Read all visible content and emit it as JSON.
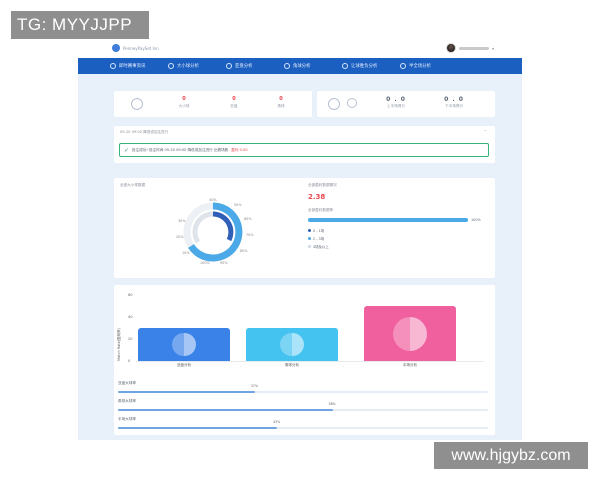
{
  "watermarks": {
    "top_left": "TG: MYYJJPP",
    "bottom_right": "www.hjgybz.com"
  },
  "header": {
    "logo_text": "PenneyPaySet Inn"
  },
  "nav": {
    "items": [
      {
        "label": "即时赛事资讯"
      },
      {
        "label": "大小球分析"
      },
      {
        "label": "亚盘分析"
      },
      {
        "label": "角球分析"
      },
      {
        "label": "让球胜负分析"
      },
      {
        "label": "半全场分析"
      }
    ]
  },
  "stats_left": [
    {
      "value": "0",
      "label": "大小球"
    },
    {
      "value": "0",
      "label": "亚盘"
    },
    {
      "value": "0",
      "label": "角球"
    }
  ],
  "stats_right": [
    {
      "value": "0 . 0",
      "label": "上半场得分"
    },
    {
      "value": "0 . 0",
      "label": "下半场得分"
    }
  ],
  "notice": {
    "header": "09-20 09:00 降低或加注进行",
    "text": "投注成功! 投注时间 09-20 09:00 降低或加注进行 比赛场数",
    "tag": "盈利 0.00"
  },
  "overview": {
    "left_title": "全部大小球数据",
    "right_title": "全部盈利数据情况",
    "big_value": "2.38",
    "progress_title": "全部盈利数据率",
    "progress_pct": 100,
    "progress_label": "100%",
    "legend": [
      {
        "label": "0 - 1场",
        "color": "#2f5fb8"
      },
      {
        "label": "2 - 3场",
        "color": "#4aa9e6"
      },
      {
        "label": "4场及以上",
        "color": "#cfd8e3"
      }
    ],
    "donut_labels": [
      "40%",
      "50%",
      "60%",
      "70%",
      "80%",
      "90%",
      "100%",
      "10%",
      "20%",
      "30%"
    ]
  },
  "chart_data": {
    "type": "bar",
    "categories": [
      "亚盘分析",
      "角球分析",
      "半场分析"
    ],
    "values": [
      30,
      30,
      50
    ],
    "colors": [
      "#3a82e8",
      "#44c2f0",
      "#f0609e"
    ],
    "yticks": [
      "60",
      "40",
      "20",
      "0"
    ],
    "ylabel": "Match Rate(盈利率)",
    "ylim": [
      0,
      60
    ]
  },
  "progress_bars": [
    {
      "label": "亚盘大球率",
      "value": 37,
      "text": "37%"
    },
    {
      "label": "角球大球率",
      "value": 58,
      "text": "58%"
    },
    {
      "label": "半场大球率",
      "value": 43,
      "text": "43%"
    }
  ]
}
